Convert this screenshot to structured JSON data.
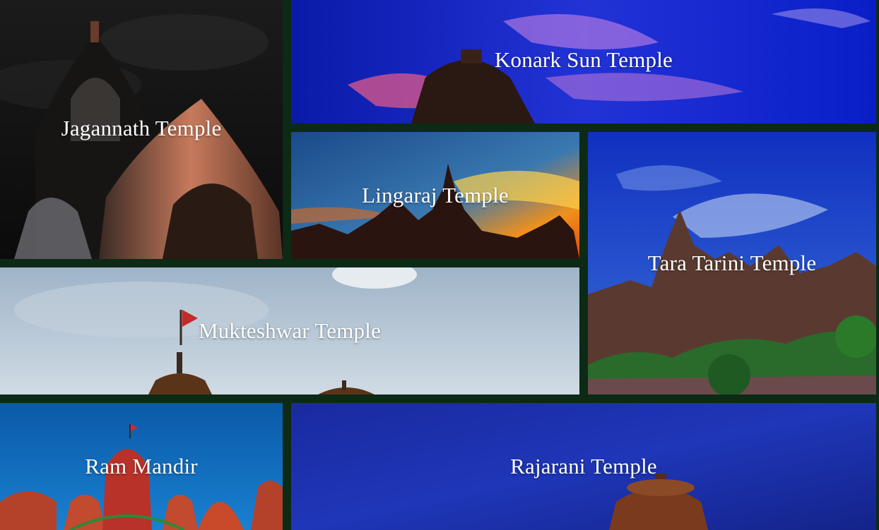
{
  "tiles": [
    {
      "id": "jagannath",
      "label": "Jagannath Temple"
    },
    {
      "id": "konark",
      "label": "Konark Sun Temple"
    },
    {
      "id": "lingaraj",
      "label": "Lingaraj Temple"
    },
    {
      "id": "tara_tarini",
      "label": "Tara Tarini Temple"
    },
    {
      "id": "mukteshwar",
      "label": "Mukteshwar Temple"
    },
    {
      "id": "ram_mandir",
      "label": "Ram Mandir"
    },
    {
      "id": "rajarani",
      "label": "Rajarani Temple"
    }
  ],
  "colors": {
    "background": "#0c2a16",
    "label_text": "#ffffff"
  }
}
